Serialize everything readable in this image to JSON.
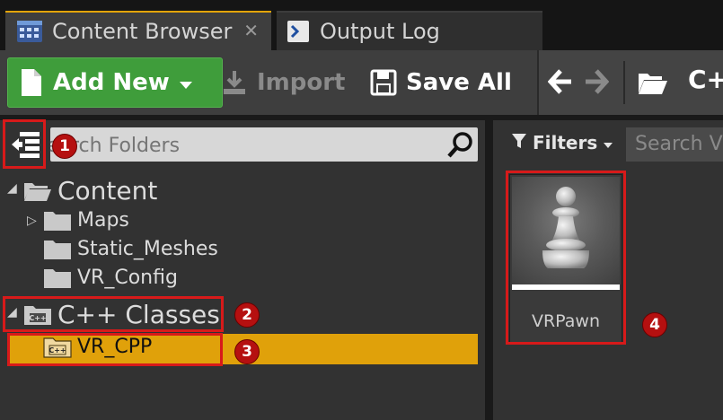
{
  "tabs": [
    {
      "label": "Content Browser",
      "close": "✕",
      "icon": "content-browser-icon"
    },
    {
      "label": "Output Log",
      "close": "✕",
      "icon": "output-log-icon"
    }
  ],
  "toolbar": {
    "add_new": "Add New",
    "import": "Import",
    "save_all": "Save All",
    "path": "C++"
  },
  "folders": {
    "search_placeholder": "Search Folders",
    "tree": [
      {
        "label": "Content"
      },
      {
        "label": "Maps"
      },
      {
        "label": "Static_Meshes"
      },
      {
        "label": "VR_Config"
      },
      {
        "label": "C++ Classes"
      },
      {
        "label": "VR_CPP"
      }
    ]
  },
  "assets": {
    "filters": "Filters",
    "search_placeholder": "Search VR_CPP",
    "items": [
      {
        "label": "VRPawn"
      }
    ]
  },
  "annotations": [
    "1",
    "2",
    "3",
    "4"
  ],
  "colors": {
    "accent": "#e2a40a",
    "selected": "#e0a10a",
    "add_new": "#3f9d3b",
    "annotation": "#d71a1a"
  }
}
